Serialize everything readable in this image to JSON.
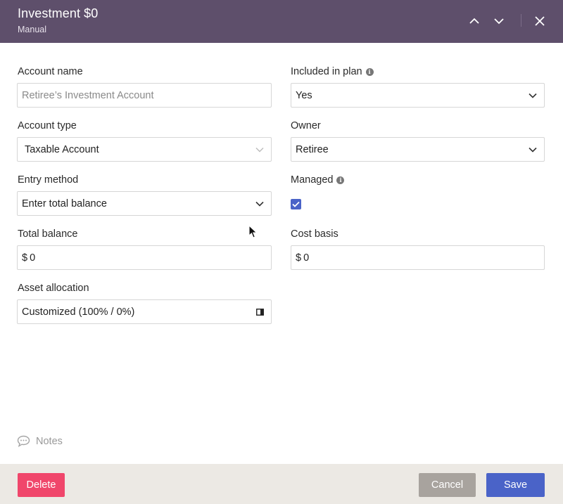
{
  "header": {
    "title": "Investment $0",
    "subtitle": "Manual",
    "prev_icon": "chevron-up-icon",
    "next_icon": "chevron-down-icon",
    "close_icon": "close-icon"
  },
  "form": {
    "account_name": {
      "label": "Account name",
      "placeholder": "Retiree’s Investment Account",
      "value": ""
    },
    "included_in_plan": {
      "label": "Included in plan",
      "value": "Yes"
    },
    "account_type": {
      "label": "Account type",
      "value": "Taxable Account"
    },
    "owner": {
      "label": "Owner",
      "value": "Retiree"
    },
    "entry_method": {
      "label": "Entry method",
      "value": "Enter total balance"
    },
    "managed": {
      "label": "Managed",
      "checked": true
    },
    "total_balance": {
      "label": "Total balance",
      "prefix": "$",
      "value": "0"
    },
    "cost_basis": {
      "label": "Cost basis",
      "prefix": "$",
      "value": "0"
    },
    "asset_allocation": {
      "label": "Asset allocation",
      "value": "Customized (100% / 0%)",
      "icon": "panel-icon"
    }
  },
  "notes": {
    "label": "Notes",
    "icon": "comment-icon"
  },
  "footer": {
    "delete_label": "Delete",
    "cancel_label": "Cancel",
    "save_label": "Save"
  },
  "colors": {
    "header_bg": "#5e4f6b",
    "accent": "#4a63c8",
    "danger": "#f0466b",
    "neutral_button": "#a8a39e",
    "footer_bg": "#ece9e4"
  }
}
